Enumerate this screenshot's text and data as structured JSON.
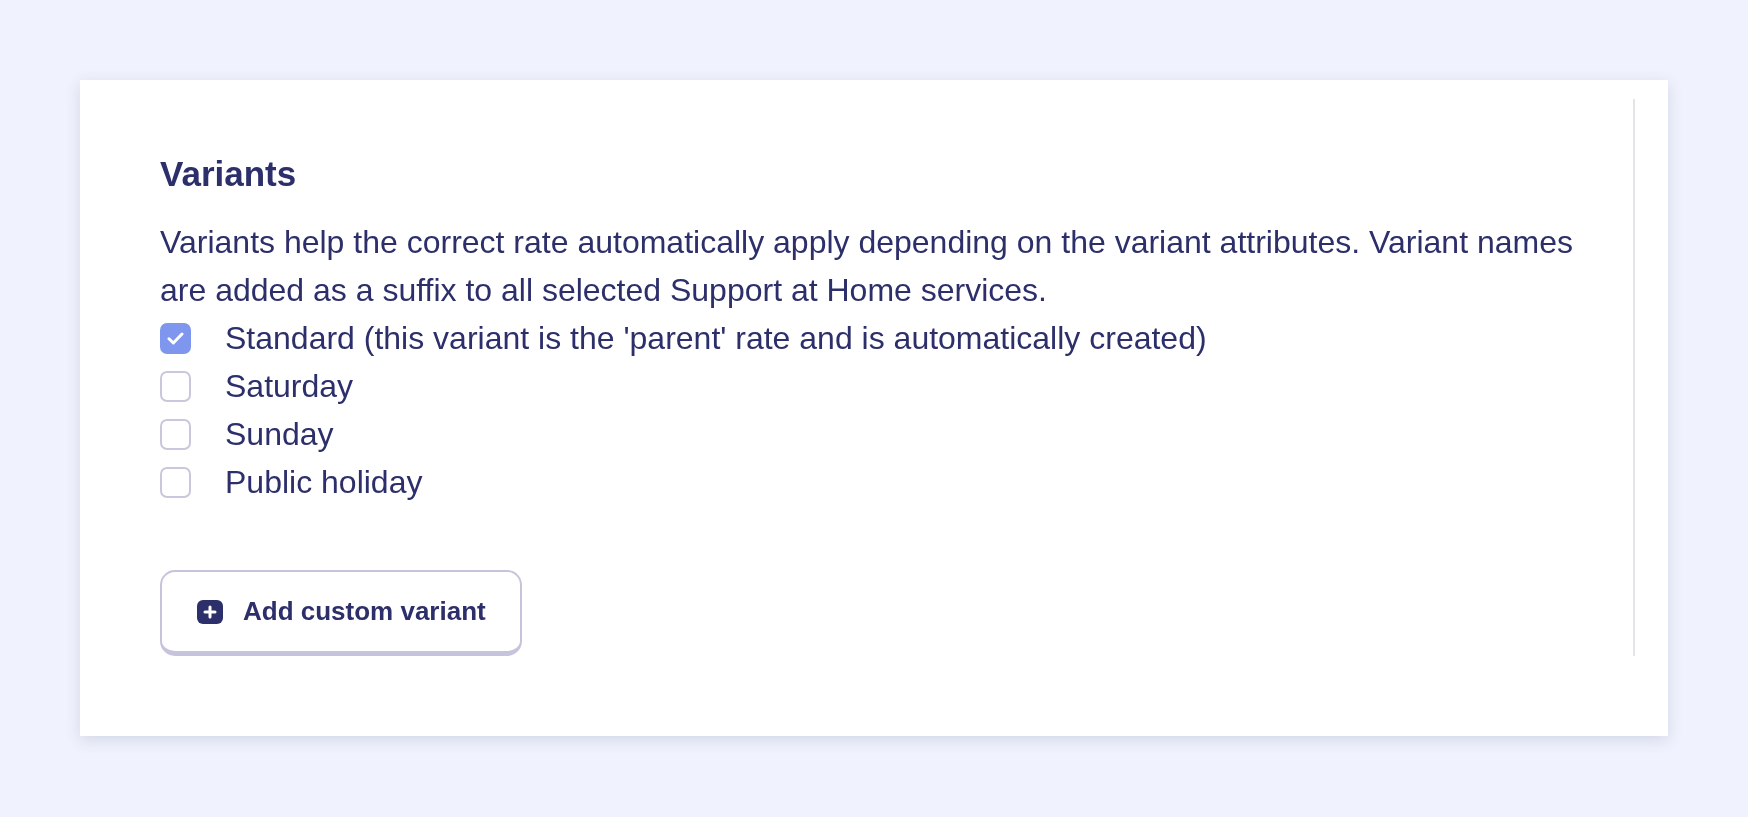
{
  "section": {
    "title": "Variants",
    "description": "Variants help the correct rate automatically apply depending on the variant attributes. Variant names are added as a suffix to all selected Support at Home services."
  },
  "variants": [
    {
      "label": "Standard (this variant is the 'parent' rate and is automatically created)",
      "checked": true
    },
    {
      "label": "Saturday",
      "checked": false
    },
    {
      "label": "Sunday",
      "checked": false
    },
    {
      "label": "Public holiday",
      "checked": false
    }
  ],
  "add_button": {
    "label": "Add custom variant"
  }
}
